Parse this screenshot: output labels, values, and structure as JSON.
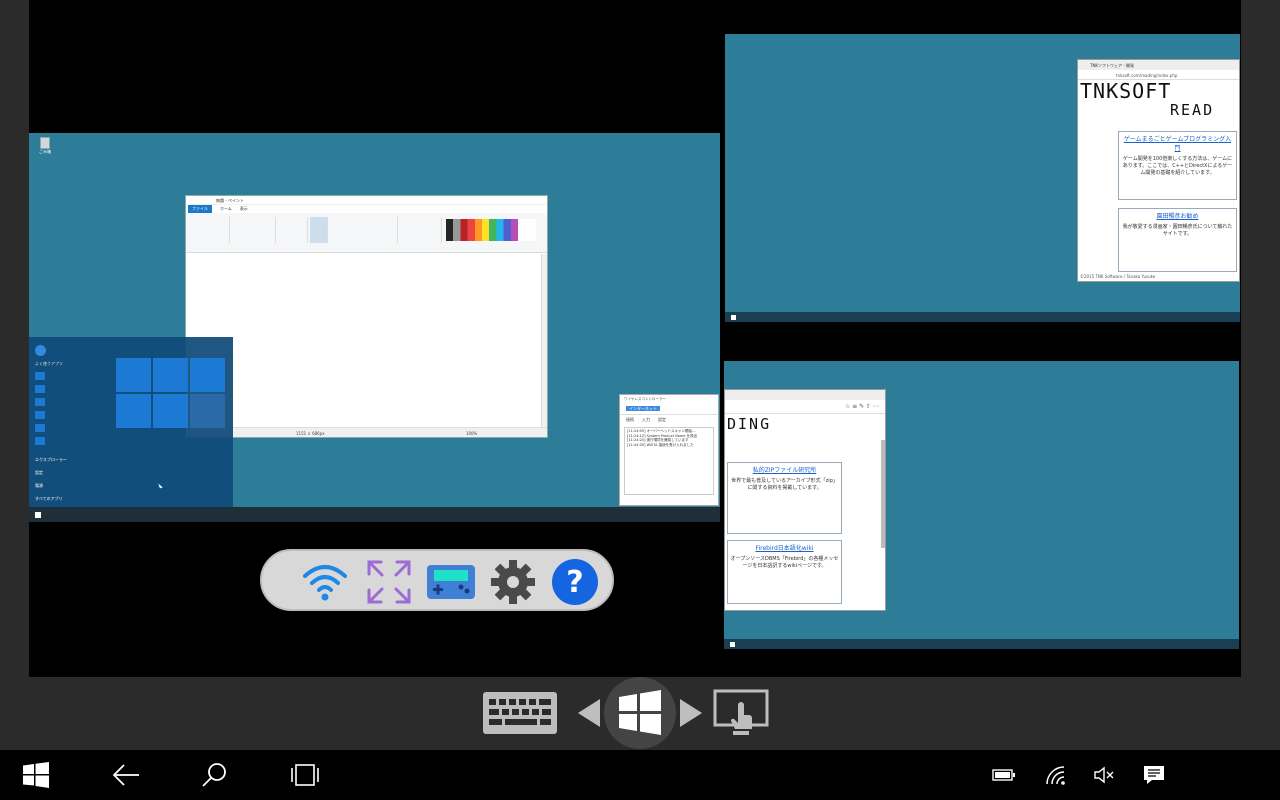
{
  "remote_main": {
    "recycle_label": "ごみ箱",
    "paint": {
      "title": "無題 - ペイント",
      "menu_file": "ファイル",
      "menu_home": "ホーム",
      "menu_view": "表示",
      "status_size": "1151 × 686px",
      "zoom": "100%"
    },
    "start_menu": {
      "most_used": "よく使うアプリ",
      "explorer": "エクスプローラー",
      "settings": "設定",
      "power": "電源",
      "all_apps": "すべてのアプリ"
    },
    "resource_monitor": {
      "title": "ワイヤレスコントローラー",
      "tab_label": "インターネット",
      "menu": [
        "接続",
        "入力",
        "設定"
      ],
      "log": [
        "[11:24:05] オーバーヘッドスキャン開始…",
        "[11:24:12] System Product Name を検出",
        "[11:24:20] 実行環境を確認しています",
        "[11:44:05] WSITA 接続を受け入れました"
      ]
    }
  },
  "remote_top_right": {
    "browser": {
      "tab_title": "TNKソフトウェア - 開発",
      "url": "tnksoft.com/reading/index.php",
      "logo": "TNKSOFT",
      "logo_sub": "READ",
      "card1_link": "ゲームまるごとゲームプログラミング入門",
      "card1_text": "ゲーム開発を100倍楽しくする方法は、ゲームにあります。ここでは、C++とDirectXによるゲーム開発の基礎を紹介しています。",
      "card2_link": "園田暢彦お勧め",
      "card2_text": "我が敬愛する漫画家・園田暢彦氏について触れたサイトです。",
      "footer": "©2015 TNK Software / Tanaka Yusuke"
    }
  },
  "remote_bottom_right": {
    "browser": {
      "logo": "DING",
      "card1_link": "私的ZIPファイル研究所",
      "card1_text": "世界で最も普及しているアーカイブ形式「zip」に関する資料を掲載しています。",
      "card2_link": "Firebird日本語化wiki",
      "card2_text": "オープンソースDBMS「Firebird」の各種メッセージを日本語訳するwikiページです。"
    }
  },
  "floating_toolbar": {
    "icons": [
      "wifi-icon",
      "fullscreen-icon",
      "gamepad-icon",
      "gear-icon",
      "help-icon"
    ]
  },
  "control_bar": {
    "icons": [
      "keyboard-icon",
      "arrow-left-icon",
      "windows-logo-icon",
      "arrow-right-icon",
      "touch-screen-icon"
    ]
  },
  "system_taskbar": {
    "icons": [
      "start-icon",
      "back-icon",
      "search-icon",
      "task-view-icon",
      "battery-icon",
      "network-icon",
      "volume-muted-icon",
      "notifications-icon"
    ]
  },
  "colors": {
    "desktop": "#2e7d98",
    "accent": "#1976d2",
    "toolbar_icon": "#1e88e5",
    "toolbar_purple": "#9c6bd6",
    "toolbar_gear": "#4a4a4a"
  }
}
